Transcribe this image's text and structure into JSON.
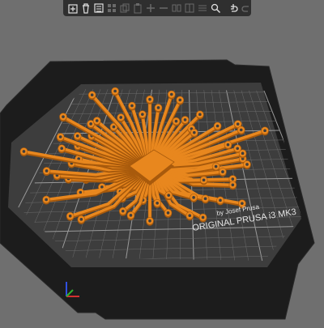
{
  "toolbar": {
    "buttons": [
      {
        "name": "add-icon",
        "enabled": true
      },
      {
        "name": "delete-icon",
        "enabled": true
      },
      {
        "name": "delete-all-icon",
        "enabled": true
      },
      {
        "name": "arrange-icon",
        "enabled": false
      },
      {
        "name": "copy-icon",
        "enabled": false
      },
      {
        "name": "paste-icon",
        "enabled": false
      },
      {
        "name": "add-instance-icon",
        "enabled": false
      },
      {
        "name": "remove-instance-icon",
        "enabled": false
      },
      {
        "name": "split-objects-icon",
        "enabled": false
      },
      {
        "name": "split-parts-icon",
        "enabled": false
      },
      {
        "name": "layers-editing-icon",
        "enabled": false
      },
      {
        "name": "search-icon",
        "enabled": true
      },
      {
        "name": "separator",
        "enabled": false
      },
      {
        "name": "undo-icon",
        "enabled": true
      },
      {
        "name": "redo-icon",
        "enabled": false
      }
    ]
  },
  "bed": {
    "brand_text": "ORIGINAL PRUSA i3 MK3",
    "author_text": "by Josef Prusa"
  },
  "colors": {
    "background": "#6f6f6f",
    "bed_dark": "#1f1f1f",
    "bed_plate": "#3a3a3a",
    "grid_line": "#8a8a8a",
    "model": "#e8871e",
    "model_shadow": "#a85a0c",
    "toolbar": "#2f2f2f",
    "axis_x": "#d23030",
    "axis_y": "#30b030",
    "axis_z": "#3050e0"
  }
}
